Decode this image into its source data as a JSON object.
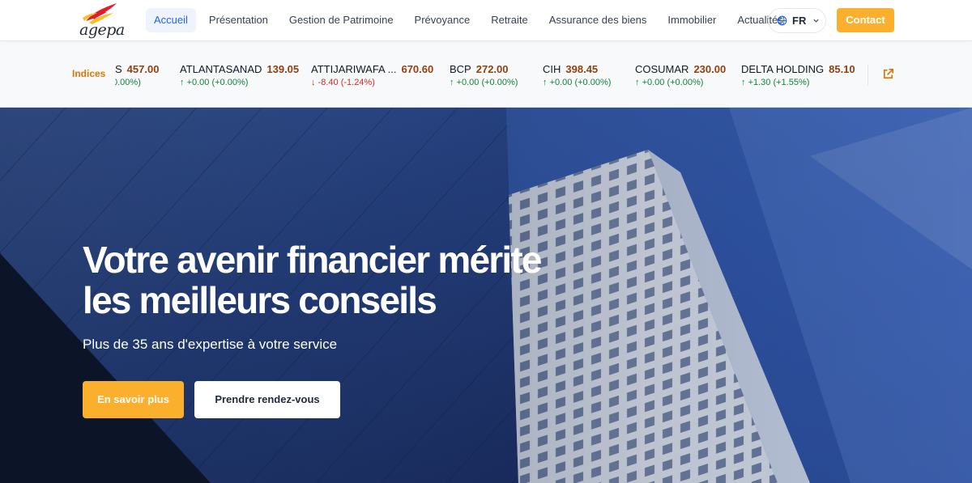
{
  "logo": {
    "text": "agepa"
  },
  "nav": {
    "items": [
      {
        "label": "Accueil",
        "active": true
      },
      {
        "label": "Présentation"
      },
      {
        "label": "Gestion de Patrimoine"
      },
      {
        "label": "Prévoyance"
      },
      {
        "label": "Retraite"
      },
      {
        "label": "Assurance des biens"
      },
      {
        "label": "Immobilier"
      },
      {
        "label": "Actualités"
      }
    ],
    "language": "FR",
    "contact_label": "Contact"
  },
  "ticker": {
    "label": "Indices",
    "items": [
      {
        "name": "S",
        "price": "457.00",
        "change": "0.00%)",
        "direction": "none"
      },
      {
        "name": "ATLANTASANAD",
        "price": "139.05",
        "change": "+0.00 (+0.00%)",
        "direction": "up"
      },
      {
        "name": "ATTIJARIWAFA ...",
        "price": "670.60",
        "change": "-8.40 (-1.24%)",
        "direction": "down"
      },
      {
        "name": "BCP",
        "price": "272.00",
        "change": "+0.00 (+0.00%)",
        "direction": "up"
      },
      {
        "name": "CIH",
        "price": "398.45",
        "change": "+0.00 (+0.00%)",
        "direction": "up"
      },
      {
        "name": "COSUMAR",
        "price": "230.00",
        "change": "+0.00 (+0.00%)",
        "direction": "up"
      },
      {
        "name": "DELTA HOLDING",
        "price": "85.10",
        "change": "+1.30 (+1.55%)",
        "direction": "up"
      }
    ]
  },
  "hero": {
    "title_line1": "Votre avenir financier mérite",
    "title_line2": "les meilleurs conseils",
    "subtitle": "Plus de 35 ans d'expertise à votre service",
    "primary_button": "En savoir plus",
    "secondary_button": "Prendre rendez-vous"
  },
  "colors": {
    "accent": "#fbb02d",
    "link_active": "#2563eb",
    "price": "#92400e",
    "up": "#15803d",
    "down": "#dc2626",
    "ticker_label": "#d97706"
  }
}
